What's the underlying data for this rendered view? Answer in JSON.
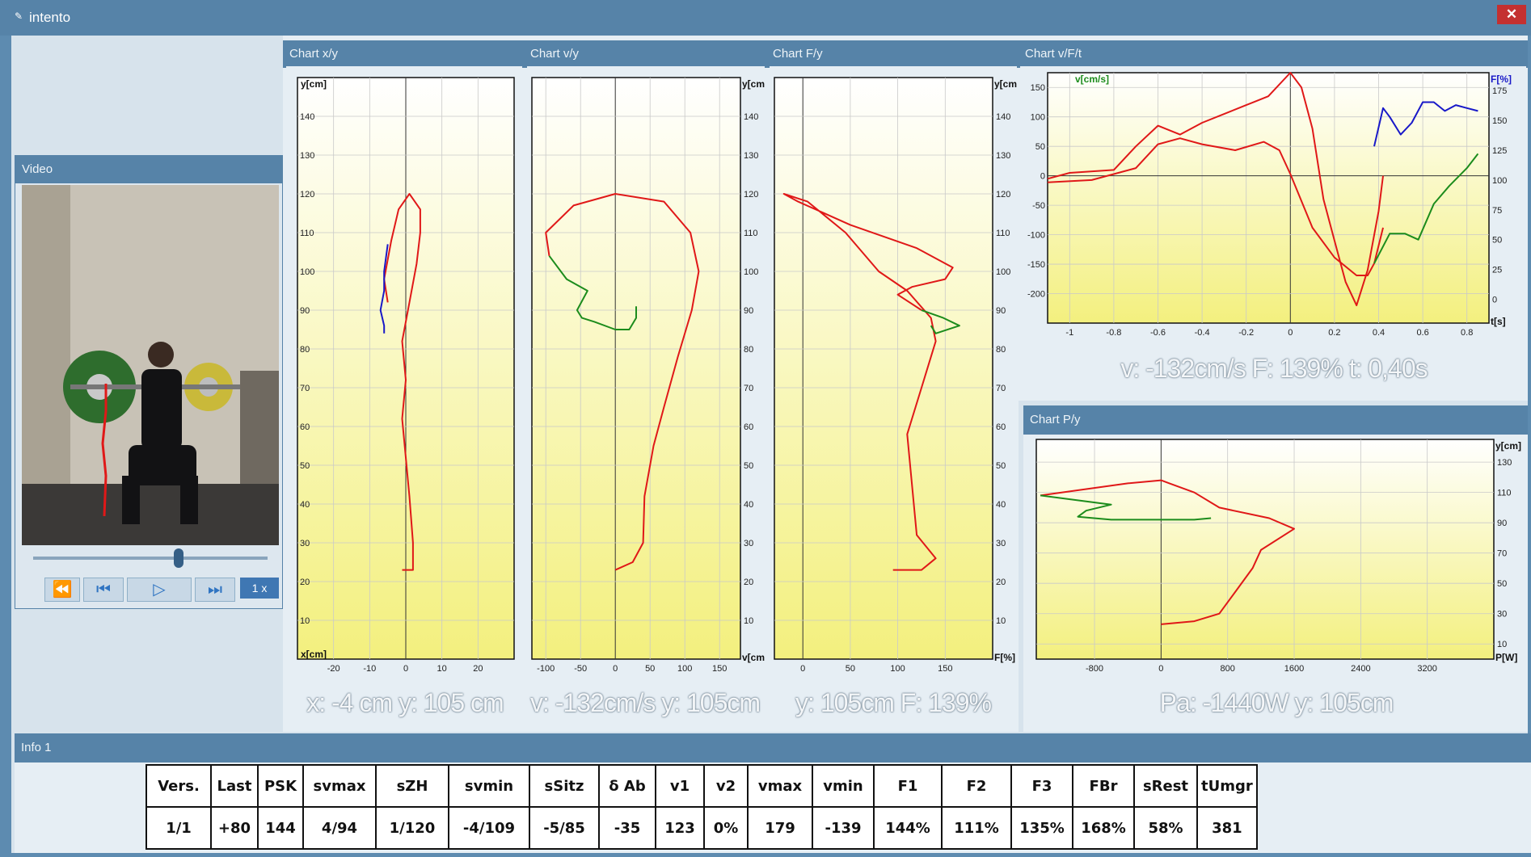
{
  "window": {
    "title": "intento",
    "close_label": "✕"
  },
  "panels": {
    "chart_xy": "Chart x/y",
    "chart_vy": "Chart v/y",
    "chart_fy": "Chart F/y",
    "chart_vft": "Chart v/F/t",
    "chart_py": "Chart P/y",
    "video": "Video",
    "info": "Info 1"
  },
  "readouts": {
    "xy": "x: -4 cm y: 105 cm",
    "vy": "v: -132cm/s y: 105cm",
    "fy": "y: 105cm F: 139%",
    "vft": "v: -132cm/s F: 139% t: 0,40s",
    "py": "Pa: -1440W y: 105cm"
  },
  "video": {
    "speed_label": "1 x",
    "playback_position": 0.62
  },
  "info_table": {
    "headers": [
      "Vers.",
      "Last",
      "PSK",
      "svmax",
      "sZH",
      "svmin",
      "sSitz",
      "δ Ab",
      "v1",
      "v2",
      "vmax",
      "vmin",
      "F1",
      "F2",
      "F3",
      "FBr",
      "sRest",
      "tUmgr"
    ],
    "values": [
      "1/1",
      "+80",
      "144",
      "4/94",
      "1/120",
      "-4/109",
      "-5/85",
      "-35",
      "123",
      "0%",
      "179",
      "-139",
      "144%",
      "111%",
      "135%",
      "168%",
      "58%",
      "381"
    ]
  },
  "colors": {
    "accent": "#5683a8",
    "plot_top": "#ffffff",
    "plot_bottom": "#f3f07e",
    "red": "#e01818",
    "green": "#1c8c1c",
    "blue": "#1818c8"
  },
  "chart_data": [
    {
      "type": "line",
      "xlabel": "x[cm]",
      "ylabel": "y[cm]",
      "xlim": [
        -30,
        30
      ],
      "ylim": [
        0,
        150
      ],
      "xticks": [
        -20,
        -10,
        0,
        10,
        20
      ],
      "yticks": [
        10,
        20,
        30,
        40,
        50,
        60,
        70,
        80,
        90,
        100,
        110,
        120,
        130,
        140
      ],
      "series": [
        {
          "color": "red",
          "points": [
            [
              -1,
              23
            ],
            [
              2,
              23
            ],
            [
              2,
              30
            ],
            [
              1,
              42
            ],
            [
              0,
              52
            ],
            [
              -1,
              62
            ],
            [
              0,
              72
            ],
            [
              -1,
              82
            ],
            [
              1,
              92
            ],
            [
              3,
              102
            ],
            [
              4,
              110
            ],
            [
              4,
              116
            ],
            [
              1,
              120
            ],
            [
              -2,
              116
            ],
            [
              -4,
              108
            ],
            [
              -6,
              98
            ],
            [
              -5,
              92
            ]
          ]
        },
        {
          "color": "blue",
          "points": [
            [
              -5,
              107
            ],
            [
              -6,
              100
            ],
            [
              -6,
              95
            ],
            [
              -7,
              90
            ],
            [
              -6,
              86
            ],
            [
              -6,
              84
            ]
          ]
        }
      ]
    },
    {
      "type": "line",
      "xlabel": "v[cm/s]",
      "ylabel": "y[cm]",
      "xlim": [
        -120,
        180
      ],
      "ylim": [
        0,
        150
      ],
      "xticks": [
        -100,
        -50,
        0,
        50,
        100,
        150
      ],
      "yticks": [
        10,
        20,
        30,
        40,
        50,
        60,
        70,
        80,
        90,
        100,
        110,
        120,
        130,
        140
      ],
      "series": [
        {
          "color": "red",
          "points": [
            [
              0,
              23
            ],
            [
              25,
              25
            ],
            [
              40,
              30
            ],
            [
              42,
              42
            ],
            [
              55,
              55
            ],
            [
              70,
              65
            ],
            [
              90,
              78
            ],
            [
              110,
              90
            ],
            [
              120,
              100
            ],
            [
              108,
              110
            ],
            [
              70,
              118
            ],
            [
              0,
              120
            ],
            [
              -60,
              117
            ],
            [
              -100,
              110
            ],
            [
              -95,
              104
            ]
          ]
        },
        {
          "color": "green",
          "points": [
            [
              -95,
              104
            ],
            [
              -70,
              98
            ],
            [
              -40,
              95
            ],
            [
              -55,
              90
            ],
            [
              -48,
              88
            ],
            [
              -30,
              87
            ],
            [
              0,
              85
            ],
            [
              20,
              85
            ],
            [
              30,
              88
            ],
            [
              30,
              91
            ]
          ]
        }
      ]
    },
    {
      "type": "line",
      "xlabel": "F[%]",
      "ylabel": "y[cm]",
      "xlim": [
        -30,
        200
      ],
      "ylim": [
        0,
        150
      ],
      "xticks": [
        0,
        50,
        100,
        150
      ],
      "yticks": [
        10,
        20,
        30,
        40,
        50,
        60,
        70,
        80,
        90,
        100,
        110,
        120,
        130,
        140
      ],
      "series": [
        {
          "color": "red",
          "points": [
            [
              95,
              23
            ],
            [
              125,
              23
            ],
            [
              140,
              26
            ],
            [
              120,
              32
            ],
            [
              115,
              45
            ],
            [
              110,
              58
            ],
            [
              125,
              70
            ],
            [
              140,
              82
            ],
            [
              135,
              88
            ],
            [
              110,
              95
            ],
            [
              80,
              100
            ],
            [
              45,
              110
            ],
            [
              5,
              118
            ],
            [
              -20,
              120
            ],
            [
              -5,
              118
            ],
            [
              50,
              112
            ],
            [
              120,
              106
            ],
            [
              158,
              101
            ],
            [
              150,
              98
            ],
            [
              115,
              96
            ],
            [
              100,
              94
            ],
            [
              125,
              90
            ]
          ]
        },
        {
          "color": "green",
          "points": [
            [
              125,
              90
            ],
            [
              148,
              88
            ],
            [
              165,
              86
            ],
            [
              140,
              84
            ],
            [
              135,
              86
            ]
          ]
        }
      ]
    },
    {
      "type": "line",
      "xlabel": "t[s]",
      "ylabel": "v[cm/s]",
      "y2label": "F[%]",
      "xlim": [
        -1.1,
        0.9
      ],
      "ylim": [
        -250,
        175
      ],
      "y2lim": [
        -20,
        190
      ],
      "xticks": [
        -1,
        -0.8,
        -0.6,
        -0.4,
        -0.2,
        0,
        0.2,
        0.4,
        0.6,
        0.8
      ],
      "yticks": [
        150,
        100,
        50,
        0,
        -50,
        -100,
        -150,
        -200
      ],
      "y2ticks": [
        175,
        150,
        125,
        100,
        75,
        50,
        25,
        0
      ],
      "series": [
        {
          "name": "v",
          "color": "red",
          "points": [
            [
              -1.1,
              -5
            ],
            [
              -1.0,
              5
            ],
            [
              -0.8,
              10
            ],
            [
              -0.7,
              50
            ],
            [
              -0.6,
              85
            ],
            [
              -0.5,
              70
            ],
            [
              -0.4,
              90
            ],
            [
              -0.3,
              105
            ],
            [
              -0.2,
              120
            ],
            [
              -0.1,
              135
            ],
            [
              0,
              175
            ],
            [
              0.05,
              150
            ],
            [
              0.1,
              80
            ],
            [
              0.15,
              -40
            ],
            [
              0.2,
              -110
            ],
            [
              0.25,
              -180
            ],
            [
              0.3,
              -220
            ],
            [
              0.35,
              -160
            ],
            [
              0.4,
              -60
            ],
            [
              0.42,
              0
            ]
          ]
        },
        {
          "name": "F",
          "color": "red",
          "points": [
            [
              -1.1,
              98
            ],
            [
              -0.9,
              100
            ],
            [
              -0.7,
              110
            ],
            [
              -0.6,
              130
            ],
            [
              -0.5,
              135
            ],
            [
              -0.4,
              130
            ],
            [
              -0.25,
              125
            ],
            [
              -0.12,
              132
            ],
            [
              -0.05,
              125
            ],
            [
              0,
              105
            ],
            [
              0.1,
              60
            ],
            [
              0.2,
              35
            ],
            [
              0.3,
              20
            ],
            [
              0.35,
              20
            ],
            [
              0.38,
              30
            ],
            [
              0.42,
              60
            ]
          ]
        },
        {
          "name": "v",
          "color": "blue",
          "points": [
            [
              0.38,
              50
            ],
            [
              0.42,
              115
            ],
            [
              0.45,
              100
            ],
            [
              0.5,
              70
            ],
            [
              0.55,
              90
            ],
            [
              0.6,
              125
            ],
            [
              0.65,
              125
            ],
            [
              0.7,
              110
            ],
            [
              0.75,
              120
            ],
            [
              0.8,
              115
            ],
            [
              0.85,
              110
            ]
          ]
        },
        {
          "name": "F",
          "color": "green",
          "points": [
            [
              0.38,
              30
            ],
            [
              0.45,
              55
            ],
            [
              0.52,
              55
            ],
            [
              0.58,
              50
            ],
            [
              0.65,
              80
            ],
            [
              0.72,
              95
            ],
            [
              0.8,
              110
            ],
            [
              0.85,
              122
            ]
          ]
        }
      ]
    },
    {
      "type": "line",
      "xlabel": "P[W]",
      "ylabel": "y[cm]",
      "xlim": [
        -1500,
        4000
      ],
      "ylim": [
        0,
        145
      ],
      "xticks": [
        -800,
        0,
        800,
        1600,
        2400,
        3200
      ],
      "yticks": [
        130,
        110,
        90,
        70,
        50,
        30,
        10
      ],
      "series": [
        {
          "color": "red",
          "points": [
            [
              0,
              23
            ],
            [
              400,
              25
            ],
            [
              700,
              30
            ],
            [
              900,
              45
            ],
            [
              1100,
              60
            ],
            [
              1200,
              72
            ],
            [
              1600,
              86
            ],
            [
              1300,
              93
            ],
            [
              700,
              100
            ],
            [
              400,
              110
            ],
            [
              100,
              116
            ],
            [
              0,
              118
            ],
            [
              -400,
              116
            ],
            [
              -1450,
              108
            ]
          ]
        },
        {
          "color": "green",
          "points": [
            [
              -1450,
              108
            ],
            [
              -600,
              102
            ],
            [
              -900,
              98
            ],
            [
              -1000,
              94
            ],
            [
              -600,
              92
            ],
            [
              0,
              92
            ],
            [
              400,
              92
            ],
            [
              600,
              93
            ]
          ]
        }
      ]
    }
  ]
}
